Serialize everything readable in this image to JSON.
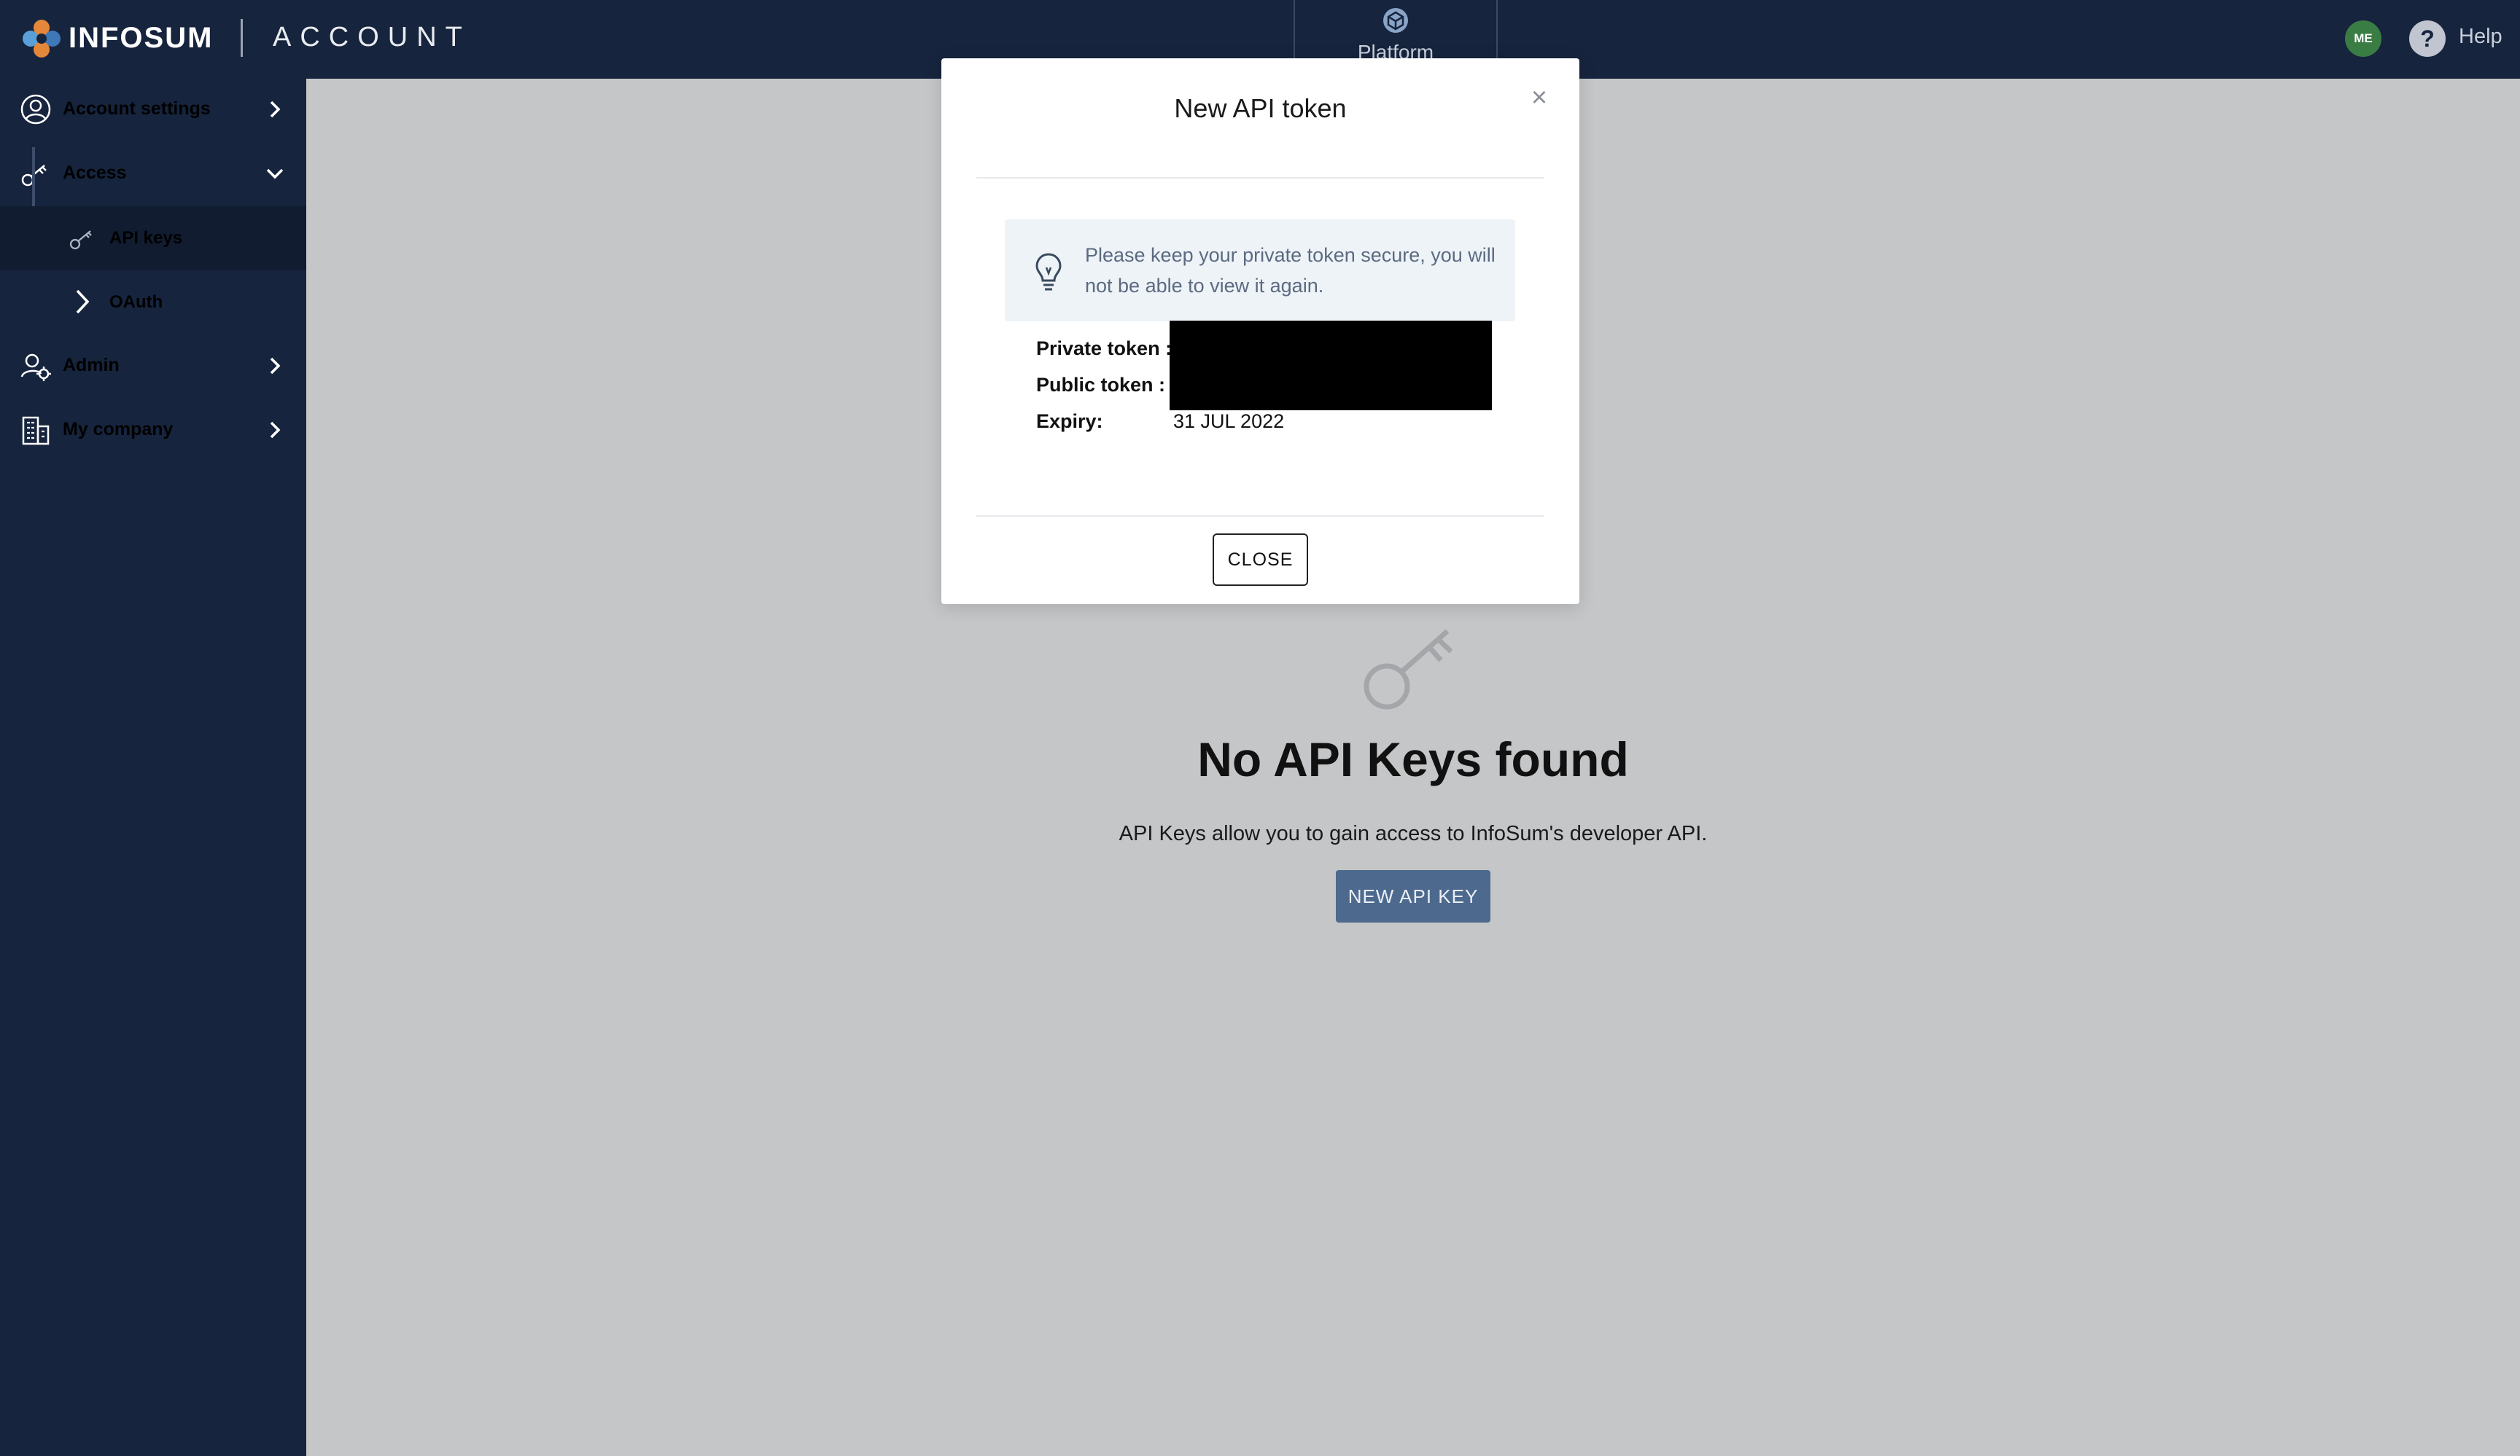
{
  "header": {
    "brand": "INFOSUM",
    "section": "ACCOUNT",
    "platform_tab": "Platform",
    "avatar_initials": "ME",
    "help_label": "Help"
  },
  "sidebar": {
    "items": [
      {
        "label": "Account settings",
        "icon": "user-circle-icon",
        "chevron": "chevron-right-icon"
      },
      {
        "label": "Access",
        "icon": "key-icon",
        "chevron": "chevron-down-icon"
      },
      {
        "label": "Admin",
        "icon": "users-gear-icon",
        "chevron": "chevron-right-icon"
      },
      {
        "label": "My company",
        "icon": "building-icon",
        "chevron": "chevron-right-icon"
      }
    ],
    "subitems": [
      {
        "label": "API keys",
        "icon": "key-icon",
        "active": true
      },
      {
        "label": "OAuth",
        "icon": "chevron-right-icon",
        "active": false
      }
    ]
  },
  "main": {
    "empty_icon": "key-icon",
    "empty_title": "No API Keys found",
    "empty_description": "API Keys allow you to gain access to InfoSum's developer API.",
    "new_key_button": "NEW API KEY"
  },
  "modal": {
    "title": "New API token",
    "close_x": "×",
    "notice_icon": "lightbulb-icon",
    "notice_text": "Please keep your private token secure, you will not be able to view it again.",
    "private_token_label": "Private token :",
    "public_token_label": "Public token :",
    "expiry_label": "Expiry:",
    "expiry_value": "31 JUL 2022",
    "close_button": "CLOSE"
  },
  "colors": {
    "nav_bg": "#16243d",
    "overlay_bg": "#c5c6c8",
    "button_accent": "#4d6a8e",
    "notice_bg": "#eef3f8",
    "avatar_bg": "#3a7d44"
  }
}
